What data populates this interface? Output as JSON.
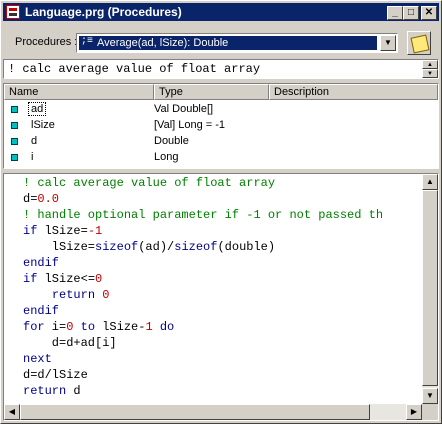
{
  "window": {
    "title": "Language.prg (Procedures)",
    "controls": {
      "minimize": "_",
      "maximize": "□",
      "close": "✕"
    }
  },
  "toolbar": {
    "procedures_label": "Procedures :",
    "procedure_glyph": ";≡",
    "procedure_value": "Average(ad, lSize): Double",
    "dropdown_icon": "chevron-down-icon",
    "notes_icon": "notepad-icon"
  },
  "description_text": "! calc average value of float array",
  "params": {
    "columns": [
      "Name",
      "Type",
      "Description"
    ],
    "rows": [
      {
        "name": "ad",
        "type": "Val Double[]",
        "description": ""
      },
      {
        "name": "lSize",
        "type": "[Val] Long = -1",
        "description": ""
      },
      {
        "name": "d",
        "type": "Double",
        "description": ""
      },
      {
        "name": "i",
        "type": "Long",
        "description": ""
      }
    ]
  },
  "code": {
    "lines": [
      [
        {
          "t": "! calc average value of float array",
          "c": "cm"
        }
      ],
      [
        {
          "t": "d=",
          "c": ""
        },
        {
          "t": "0.0",
          "c": "num"
        }
      ],
      [
        {
          "t": "! handle optional parameter if -1 or not passed th",
          "c": "cm"
        }
      ],
      [
        {
          "t": "if",
          "c": "kw"
        },
        {
          "t": " lSize=",
          "c": ""
        },
        {
          "t": "-1",
          "c": "num"
        }
      ],
      [
        {
          "t": "    lSize=",
          "c": ""
        },
        {
          "t": "sizeof",
          "c": "kw"
        },
        {
          "t": "(ad)/",
          "c": ""
        },
        {
          "t": "sizeof",
          "c": "kw"
        },
        {
          "t": "(double)",
          "c": ""
        }
      ],
      [
        {
          "t": "endif",
          "c": "kw"
        }
      ],
      [
        {
          "t": "if",
          "c": "kw"
        },
        {
          "t": " lSize<=",
          "c": ""
        },
        {
          "t": "0",
          "c": "num"
        }
      ],
      [
        {
          "t": "    ",
          "c": ""
        },
        {
          "t": "return",
          "c": "kw"
        },
        {
          "t": " ",
          "c": ""
        },
        {
          "t": "0",
          "c": "num"
        }
      ],
      [
        {
          "t": "endif",
          "c": "kw"
        }
      ],
      [
        {
          "t": "for",
          "c": "kw"
        },
        {
          "t": " i=",
          "c": ""
        },
        {
          "t": "0",
          "c": "num"
        },
        {
          "t": " ",
          "c": ""
        },
        {
          "t": "to",
          "c": "kw"
        },
        {
          "t": " lSize-",
          "c": ""
        },
        {
          "t": "1",
          "c": "num"
        },
        {
          "t": " ",
          "c": ""
        },
        {
          "t": "do",
          "c": "kw"
        }
      ],
      [
        {
          "t": "    d=d+ad[i]",
          "c": ""
        }
      ],
      [
        {
          "t": "next",
          "c": "kw"
        }
      ],
      [
        {
          "t": "d=d/lSize",
          "c": ""
        }
      ],
      [
        {
          "t": "return",
          "c": "kw"
        },
        {
          "t": " d",
          "c": ""
        }
      ]
    ]
  },
  "colors": {
    "title_bar": "#0a246a",
    "comment": "#008000",
    "keyword": "#00008b",
    "number": "#c00000",
    "param_marker": "#00c0c0"
  },
  "scrollbar_icons": {
    "up": "▲",
    "down": "▼",
    "left": "◀",
    "right": "▶"
  }
}
